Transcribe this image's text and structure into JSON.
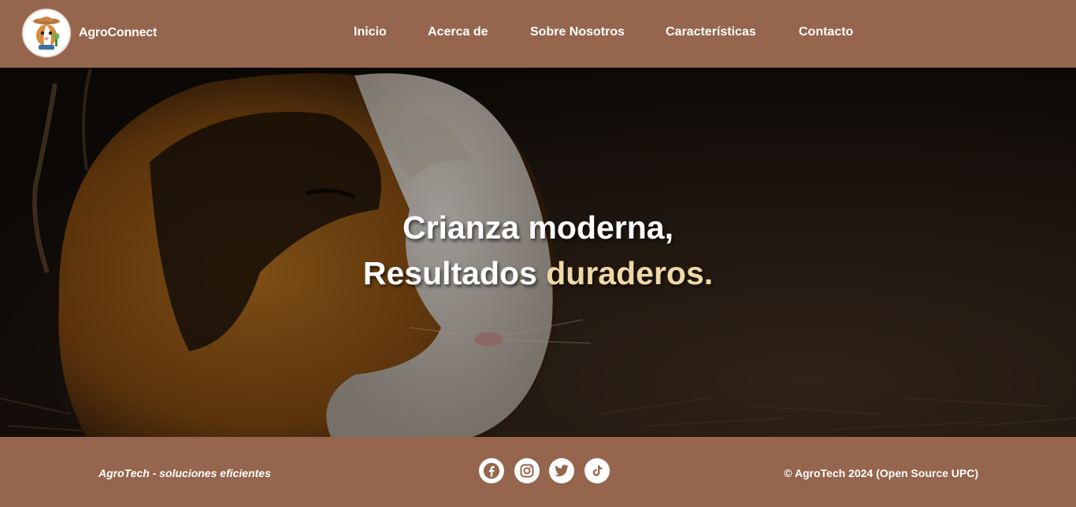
{
  "brand": {
    "name": "AgroConnect",
    "logo_icon": "guinea-pig-farmer-logo"
  },
  "nav": {
    "links": [
      {
        "label": "Inicio"
      },
      {
        "label": "Acerca de"
      },
      {
        "label": "Sobre Nosotros"
      },
      {
        "label": "Características"
      },
      {
        "label": "Contacto"
      }
    ]
  },
  "hero": {
    "line1": "Crianza moderna,",
    "line2_prefix": "Resultados ",
    "line2_accent": "duraderos.",
    "image": "guinea-pig-photo"
  },
  "footer": {
    "tagline": "AgroTech - soluciones eficientes",
    "copyright": "© AgroTech 2024 (Open Source UPC)",
    "socials": [
      {
        "icon": "facebook-icon"
      },
      {
        "icon": "instagram-icon"
      },
      {
        "icon": "twitter-icon"
      },
      {
        "icon": "tiktok-icon"
      }
    ]
  },
  "colors": {
    "primary": "#95654d",
    "accent": "#f0d9a6",
    "text": "#ffffff"
  }
}
